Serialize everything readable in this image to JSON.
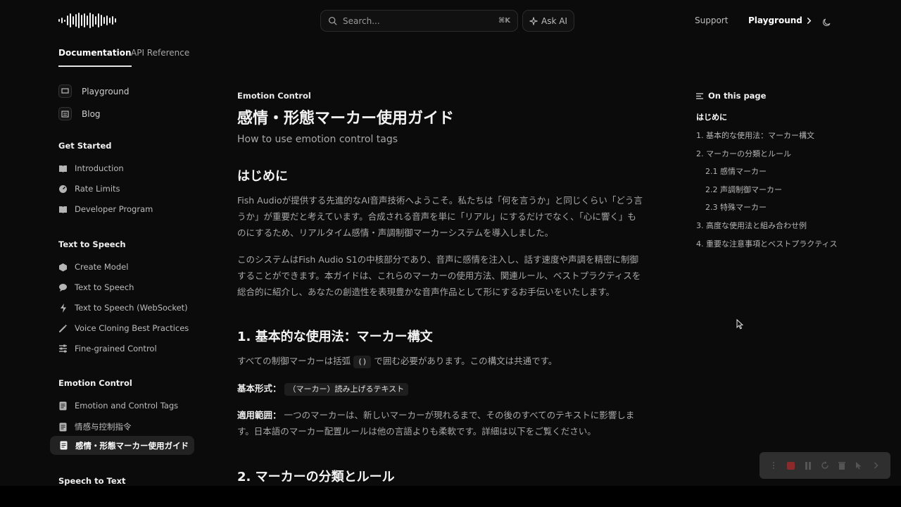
{
  "header": {
    "search_placeholder": "Search...",
    "search_shortcut": "⌘K",
    "ask_ai_label": "Ask AI",
    "support_label": "Support",
    "playground_label": "Playground"
  },
  "tabs": [
    {
      "label": "Documentation"
    },
    {
      "label": "API Reference"
    }
  ],
  "sidebar": {
    "top_links": [
      {
        "label": "Playground"
      },
      {
        "label": "Blog"
      }
    ],
    "get_started": {
      "title": "Get Started",
      "items": [
        {
          "label": "Introduction"
        },
        {
          "label": "Rate Limits"
        },
        {
          "label": "Developer Program"
        }
      ]
    },
    "tts": {
      "title": "Text to Speech",
      "items": [
        {
          "label": "Create Model"
        },
        {
          "label": "Text to Speech"
        },
        {
          "label": "Text to Speech (WebSocket)"
        },
        {
          "label": "Voice Cloning Best Practices"
        },
        {
          "label": "Fine-grained Control"
        }
      ]
    },
    "emotion": {
      "title": "Emotion Control",
      "items": [
        {
          "label": "Emotion and Control Tags"
        },
        {
          "label": "情感与控制指令"
        },
        {
          "label": "感情・形態マーカー使用ガイド"
        }
      ]
    },
    "stt": {
      "title": "Speech to Text"
    }
  },
  "content": {
    "eyebrow": "Emotion Control",
    "title": "感情・形態マーカー使用ガイド",
    "subtitle": "How to use emotion control tags",
    "intro_heading": "はじめに",
    "intro_p1": "Fish Audioが提供する先進的なAI音声技術へようこそ。私たちは「何を言うか」と同じくらい「どう言うか」が重要だと考えています。合成される音声を単に「リアル」にするだけでなく、「心に響く」ものにするため、リアルタイム感情・声調制御マーカーシステムを導入しました。",
    "intro_p2": "このシステムはFish Audio S1の中核部分であり、音声に感情を注入し、話す速度や声調を精密に制御することができます。本ガイドは、これらのマーカーの使用方法、関連ルール、ベストプラクティスを総合的に紹介し、あなたの創造性を表現豊かな音声作品として形にするお手伝いをいたします。",
    "section1_heading": "1. 基本的な使用法：マーカー構文",
    "section1_p1_before": "すべての制御マーカーは括弧",
    "section1_p1_code": "()",
    "section1_p1_after": "で囲む必要があります。この構文は共通です。",
    "format_label": "基本形式：",
    "format_code": "（マーカー）読み上げるテキスト",
    "scope_label": "適用範囲：",
    "scope_text": "一つのマーカーは、新しいマーカーが現れるまで、その後のすべてのテキストに影響します。日本語のマーカー配置ルールは他の言語よりも柔軟です。詳細は以下をご覧ください。",
    "section2_heading": "2. マーカーの分類とルール"
  },
  "toc": {
    "title": "On this page",
    "items": [
      {
        "label": "はじめに"
      },
      {
        "label": "1. 基本的な使用法：マーカー構文"
      },
      {
        "label": "2. マーカーの分類とルール"
      },
      {
        "label": "2.1 感情マーカー"
      },
      {
        "label": "2.2 声調制御マーカー"
      },
      {
        "label": "2.3 特殊マーカー"
      },
      {
        "label": "3. 高度な使用法と組み合わせ例"
      },
      {
        "label": "4. 重要な注意事項とベストプラクティス"
      }
    ]
  }
}
